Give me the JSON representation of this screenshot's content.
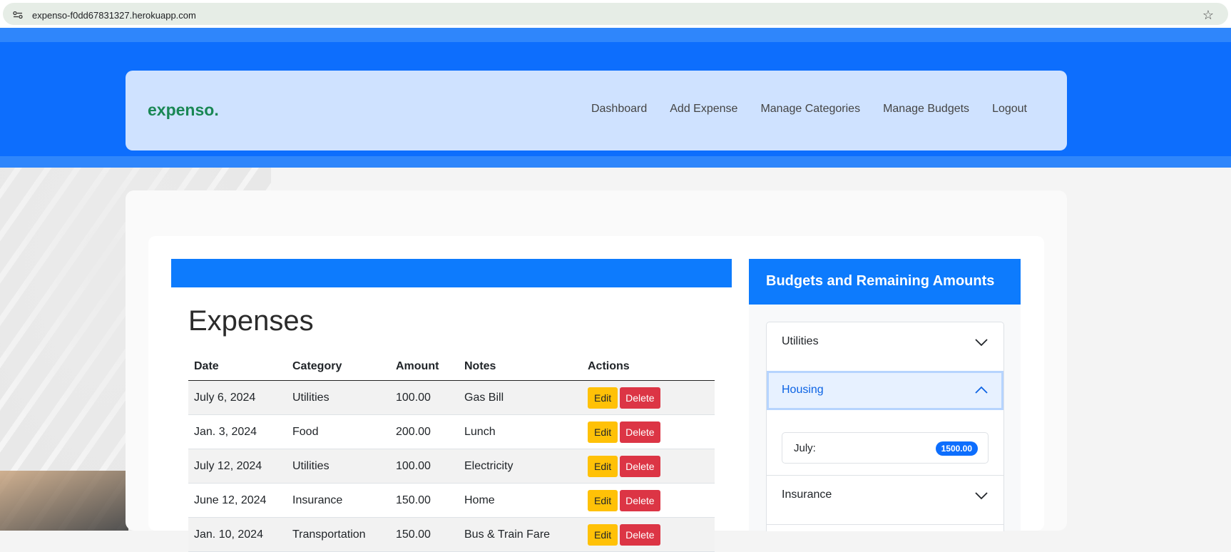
{
  "browser": {
    "url": "expenso-f0dd67831327.herokuapp.com"
  },
  "navbar": {
    "brand": "expenso.",
    "links": [
      "Dashboard",
      "Add Expense",
      "Manage Categories",
      "Manage Budgets",
      "Logout"
    ]
  },
  "expenses": {
    "title": "Expenses",
    "columns": [
      "Date",
      "Category",
      "Amount",
      "Notes",
      "Actions"
    ],
    "rows": [
      {
        "date": "July 6, 2024",
        "category": "Utilities",
        "amount": "100.00",
        "notes": "Gas Bill"
      },
      {
        "date": "Jan. 3, 2024",
        "category": "Food",
        "amount": "200.00",
        "notes": "Lunch"
      },
      {
        "date": "July 12, 2024",
        "category": "Utilities",
        "amount": "100.00",
        "notes": "Electricity"
      },
      {
        "date": "June 12, 2024",
        "category": "Insurance",
        "amount": "150.00",
        "notes": "Home"
      },
      {
        "date": "Jan. 10, 2024",
        "category": "Transportation",
        "amount": "150.00",
        "notes": "Bus & Train Fare"
      }
    ],
    "edit_label": "Edit",
    "delete_label": "Delete"
  },
  "budgets": {
    "title": "Budgets and Remaining Amounts",
    "categories": [
      "Utilities",
      "Housing",
      "Insurance"
    ],
    "open_category": "Housing",
    "entry": {
      "month": "July:",
      "amount": "1500.00"
    }
  },
  "colors": {
    "primary": "#0d6efd",
    "brand_green": "#198754",
    "warning": "#ffc107",
    "danger": "#dc3545",
    "navbar_bg": "#cfe2ff"
  }
}
